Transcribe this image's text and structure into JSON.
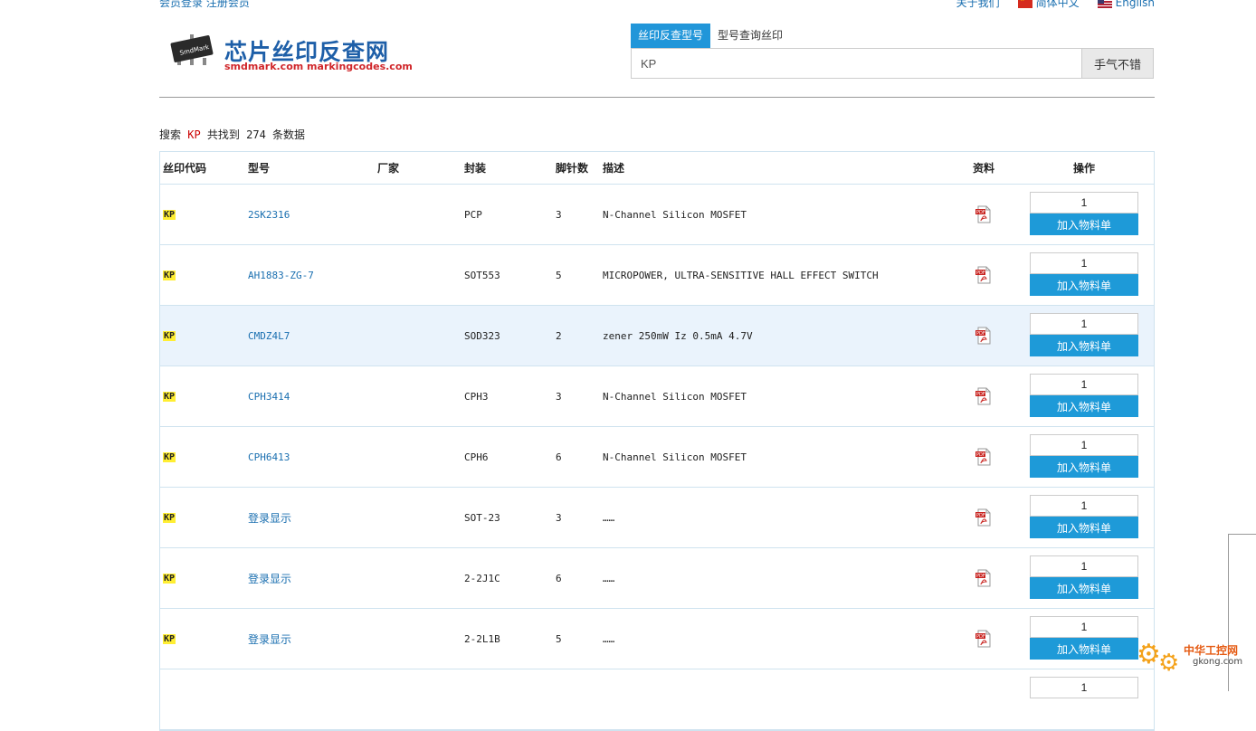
{
  "topbar": {
    "login_links": "会员登录 注册会员",
    "about": "关于我们",
    "lang_cn": "简体中文",
    "lang_en": "English"
  },
  "logo": {
    "chip_text": "SmdMark",
    "title": "芯片丝印反查网",
    "subtitle": "smdmark.com  markingcodes.com"
  },
  "search": {
    "tabs": [
      "丝印反查型号",
      "型号查询丝印"
    ],
    "value": "KP",
    "button": "手气不错"
  },
  "summary": {
    "prefix": "搜索 ",
    "keyword": "KP",
    "suffix": " 共找到 274 条数据"
  },
  "table": {
    "headers": {
      "code": "丝印代码",
      "model": "型号",
      "manufacturer": "厂家",
      "package": "封装",
      "pins": "脚针数",
      "description": "描述",
      "datasheet": "资料",
      "action": "操作"
    },
    "rows": [
      {
        "code": "KP",
        "model": "2SK2316",
        "manufacturer": "",
        "package": "PCP",
        "pins": "3",
        "description": "N-Channel Silicon MOSFET",
        "qty": "1",
        "add": "加入物料单"
      },
      {
        "code": "KP",
        "model": "AH1883-ZG-7",
        "manufacturer": "",
        "package": "SOT553",
        "pins": "5",
        "description": "MICROPOWER, ULTRA-SENSITIVE HALL EFFECT SWITCH",
        "qty": "1",
        "add": "加入物料单"
      },
      {
        "code": "KP",
        "model": "CMDZ4L7",
        "manufacturer": "",
        "package": "SOD323",
        "pins": "2",
        "description": "zener 250mW Iz 0.5mA 4.7V",
        "qty": "1",
        "add": "加入物料单"
      },
      {
        "code": "KP",
        "model": "CPH3414",
        "manufacturer": "",
        "package": "CPH3",
        "pins": "3",
        "description": "N-Channel Silicon MOSFET",
        "qty": "1",
        "add": "加入物料单"
      },
      {
        "code": "KP",
        "model": "CPH6413",
        "manufacturer": "",
        "package": "CPH6",
        "pins": "6",
        "description": "N-Channel Silicon MOSFET",
        "qty": "1",
        "add": "加入物料单"
      },
      {
        "code": "KP",
        "model": "登录显示",
        "manufacturer": "",
        "package": "SOT-23",
        "pins": "3",
        "description": "……",
        "qty": "1",
        "add": "加入物料单"
      },
      {
        "code": "KP",
        "model": "登录显示",
        "manufacturer": "",
        "package": "2-2J1C",
        "pins": "6",
        "description": "……",
        "qty": "1",
        "add": "加入物料单"
      },
      {
        "code": "KP",
        "model": "登录显示",
        "manufacturer": "",
        "package": "2-2L1B",
        "pins": "5",
        "description": "……",
        "qty": "1",
        "add": "加入物料单"
      },
      {
        "code": "",
        "model": "",
        "manufacturer": "",
        "package": "",
        "pins": "",
        "description": "",
        "qty": "1",
        "add": ""
      }
    ]
  },
  "watermark": {
    "title": "中华工控网",
    "url": "gkong.com"
  }
}
